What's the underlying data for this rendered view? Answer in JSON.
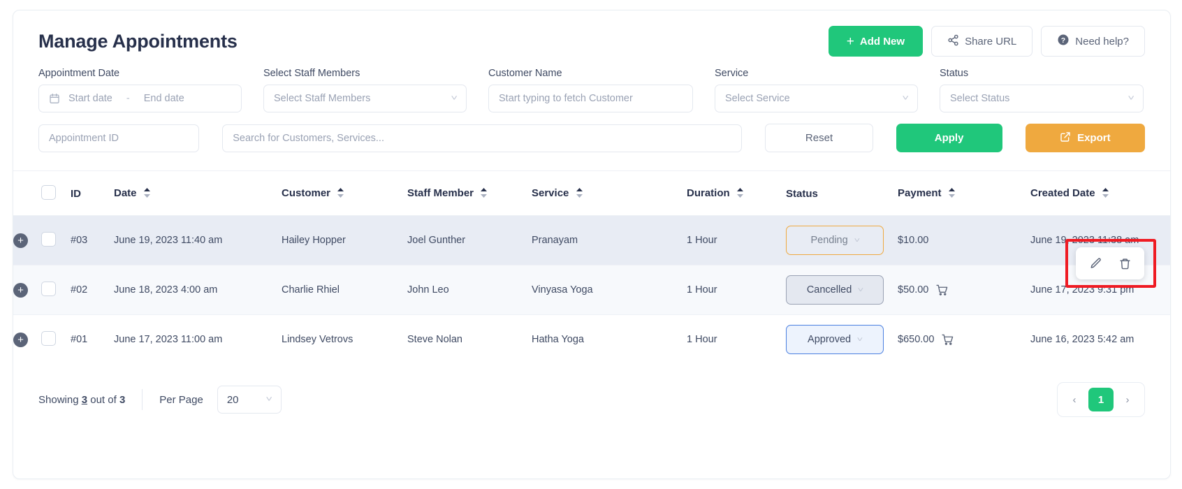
{
  "header": {
    "title": "Manage Appointments",
    "add_new_label": "Add New",
    "share_url_label": "Share URL",
    "need_help_label": "Need help?"
  },
  "filters": {
    "appointment_date": {
      "label": "Appointment Date",
      "start_placeholder": "Start date",
      "separator": "-",
      "end_placeholder": "End date"
    },
    "staff": {
      "label": "Select Staff Members",
      "value": "Select Staff Members"
    },
    "customer": {
      "label": "Customer Name",
      "placeholder": "Start typing to fetch Customer",
      "value": ""
    },
    "service": {
      "label": "Service",
      "value": "Select Service"
    },
    "status": {
      "label": "Status",
      "value": "Select Status"
    },
    "appointment_id": {
      "placeholder": "Appointment ID",
      "value": ""
    },
    "search": {
      "placeholder": "Search for Customers, Services...",
      "value": ""
    },
    "reset_label": "Reset",
    "apply_label": "Apply",
    "export_label": "Export"
  },
  "table": {
    "columns": [
      {
        "key": "id",
        "label": "ID",
        "sortable": false
      },
      {
        "key": "date",
        "label": "Date",
        "sortable": true
      },
      {
        "key": "customer",
        "label": "Customer",
        "sortable": true
      },
      {
        "key": "staff",
        "label": "Staff Member",
        "sortable": true
      },
      {
        "key": "service",
        "label": "Service",
        "sortable": true
      },
      {
        "key": "duration",
        "label": "Duration",
        "sortable": true
      },
      {
        "key": "status",
        "label": "Status",
        "sortable": false
      },
      {
        "key": "payment",
        "label": "Payment",
        "sortable": true
      },
      {
        "key": "created",
        "label": "Created Date",
        "sortable": true
      }
    ],
    "rows": [
      {
        "id": "#03",
        "date": "June 19, 2023 11:40 am",
        "customer": "Hailey Hopper",
        "staff": "Joel Gunther",
        "service": "Pranayam",
        "duration": "1 Hour",
        "status": "Pending",
        "status_type": "pending",
        "payment": "$10.00",
        "has_cart": false,
        "created": "June 19, 2023 11:38 am",
        "highlighted": true
      },
      {
        "id": "#02",
        "date": "June 18, 2023 4:00 am",
        "customer": "Charlie Rhiel",
        "staff": "John Leo",
        "service": "Vinyasa Yoga",
        "duration": "1 Hour",
        "status": "Cancelled",
        "status_type": "cancelled",
        "payment": "$50.00",
        "has_cart": true,
        "created": "June 17, 2023 9:31 pm",
        "highlighted": false
      },
      {
        "id": "#01",
        "date": "June 17, 2023 11:00 am",
        "customer": "Lindsey Vetrovs",
        "staff": "Steve Nolan",
        "service": "Hatha Yoga",
        "duration": "1 Hour",
        "status": "Approved",
        "status_type": "approved",
        "payment": "$650.00",
        "has_cart": true,
        "created": "June 16, 2023 5:42 am",
        "highlighted": false
      }
    ]
  },
  "row_actions": {
    "edit_label": "Edit",
    "delete_label": "Delete"
  },
  "footer": {
    "showing_prefix": "Showing",
    "showing_count": "3",
    "showing_middle": "out of",
    "showing_total": "3",
    "per_page_label": "Per Page",
    "per_page_value": "20",
    "prev_label": "‹",
    "current_page": "1",
    "next_label": "›"
  },
  "colors": {
    "accent_green": "#20c77b",
    "export_orange": "#efa93f",
    "annotation_red": "#ef1b23",
    "approved_blue": "#4a7fe0",
    "title_navy": "#27304b"
  }
}
